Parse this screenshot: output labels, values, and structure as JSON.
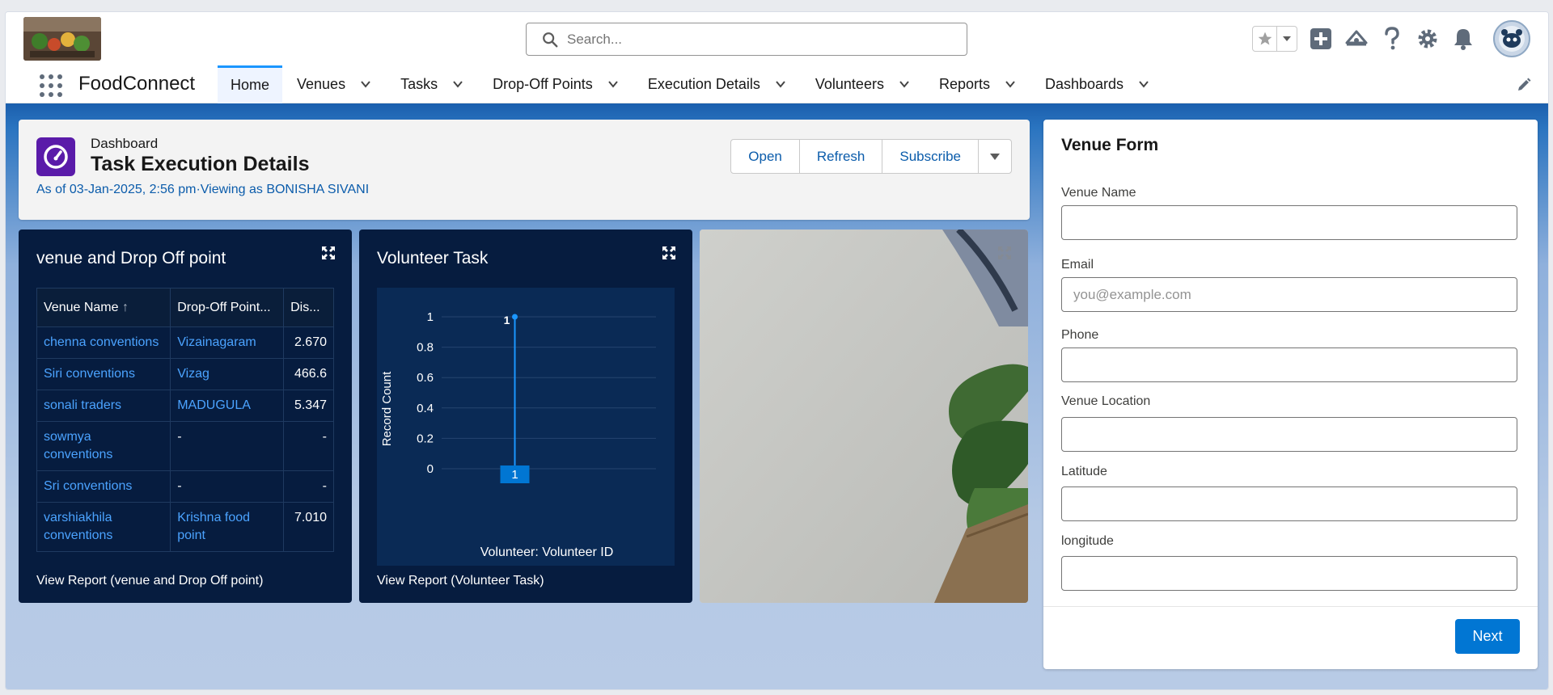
{
  "search": {
    "placeholder": "Search..."
  },
  "app": {
    "name": "FoodConnect"
  },
  "nav": {
    "items": [
      {
        "label": "Home"
      },
      {
        "label": "Venues"
      },
      {
        "label": "Tasks"
      },
      {
        "label": "Drop-Off Points"
      },
      {
        "label": "Execution Details"
      },
      {
        "label": "Volunteers"
      },
      {
        "label": "Reports"
      },
      {
        "label": "Dashboards"
      }
    ]
  },
  "dashboard": {
    "label": "Dashboard",
    "title": "Task Execution Details",
    "as_of": "As of 03-Jan-2025, 2:56 pm·Viewing as BONISHA SIVANI",
    "buttons": {
      "open": "Open",
      "refresh": "Refresh",
      "subscribe": "Subscribe"
    }
  },
  "widget_venue": {
    "title": "venue and Drop Off point",
    "columns": [
      "Venue Name",
      "Drop-Off Point...",
      "Dis..."
    ],
    "rows": [
      [
        "chenna conventions",
        "Vizainagaram",
        "2.670"
      ],
      [
        "Siri conventions",
        "Vizag",
        "466.6"
      ],
      [
        "sonali traders",
        "MADUGULA",
        "5.347"
      ],
      [
        "sowmya conventions",
        "-",
        "-"
      ],
      [
        "Sri conventions",
        "-",
        "-"
      ],
      [
        "varshiakhila conventions",
        "Krishna food point",
        "7.010"
      ]
    ],
    "footer": "View Report (venue and Drop Off point)"
  },
  "widget_volunteer": {
    "title": "Volunteer Task",
    "footer": "View Report (Volunteer Task)"
  },
  "chart_data": {
    "type": "bar",
    "categories": [
      ""
    ],
    "values": [
      1
    ],
    "data_labels": [
      "1",
      "1"
    ],
    "ylabel": "Record Count",
    "xlabel": "Volunteer: Volunteer ID",
    "ylim": [
      0,
      1
    ],
    "yticks": [
      "0",
      "0.2",
      "0.4",
      "0.6",
      "0.8",
      "1"
    ],
    "grid": true
  },
  "venue_form": {
    "title": "Venue Form",
    "fields": {
      "venue_name": {
        "label": "Venue Name",
        "value": "",
        "placeholder": ""
      },
      "email": {
        "label": "Email",
        "value": "",
        "placeholder": "you@example.com"
      },
      "phone": {
        "label": "Phone",
        "value": "",
        "placeholder": ""
      },
      "venue_location": {
        "label": "Venue Location",
        "value": "",
        "placeholder": ""
      },
      "latitude": {
        "label": "Latitude",
        "value": "",
        "placeholder": ""
      },
      "longitude": {
        "label": "longitude",
        "value": "",
        "placeholder": ""
      }
    },
    "next_label": "Next"
  },
  "colors": {
    "brand": "#0176d3",
    "link": "#0b5cab",
    "dashboard_icon": "#5a1ba9",
    "widget_bg": "#061c3f",
    "chart_line": "#1b96ff"
  },
  "icons": [
    "search-icon",
    "star-icon",
    "chevron-down-icon",
    "plus-icon",
    "cloud-icon",
    "help-icon",
    "gear-icon",
    "bell-icon",
    "app-launcher-icon",
    "pencil-icon",
    "gauge-icon",
    "expand-icon"
  ]
}
